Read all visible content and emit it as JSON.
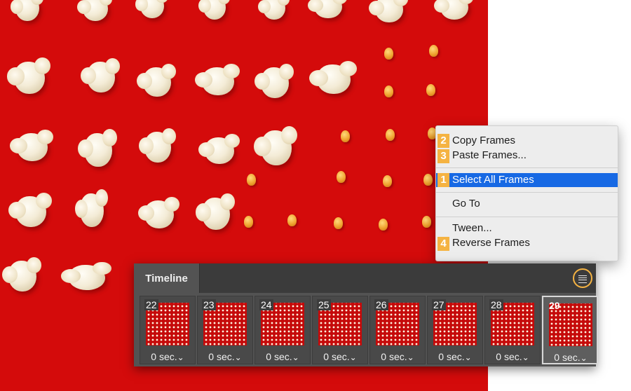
{
  "context_menu": {
    "items": [
      {
        "label": "Copy Frames",
        "step": "2"
      },
      {
        "label": "Paste Frames...",
        "step": "3"
      },
      {
        "label": "Select All Frames",
        "step": "1"
      },
      {
        "label": "Go To",
        "step": ""
      },
      {
        "label": "Tween...",
        "step": ""
      },
      {
        "label": "Reverse Frames",
        "step": "4"
      }
    ],
    "selected_item": "Select All Frames",
    "highlight_color": "#1769e4",
    "badge_color": "#f5b342"
  },
  "timeline": {
    "title": "Timeline",
    "menu_icon": "panel-menu-icon",
    "frames": [
      {
        "number": "22",
        "duration": "0 sec."
      },
      {
        "number": "23",
        "duration": "0 sec."
      },
      {
        "number": "24",
        "duration": "0 sec."
      },
      {
        "number": "25",
        "duration": "0 sec."
      },
      {
        "number": "26",
        "duration": "0 sec."
      },
      {
        "number": "27",
        "duration": "0 sec."
      },
      {
        "number": "28",
        "duration": "0 sec."
      },
      {
        "number": "29",
        "duration": "0 sec."
      }
    ],
    "selected_frame": "29"
  }
}
